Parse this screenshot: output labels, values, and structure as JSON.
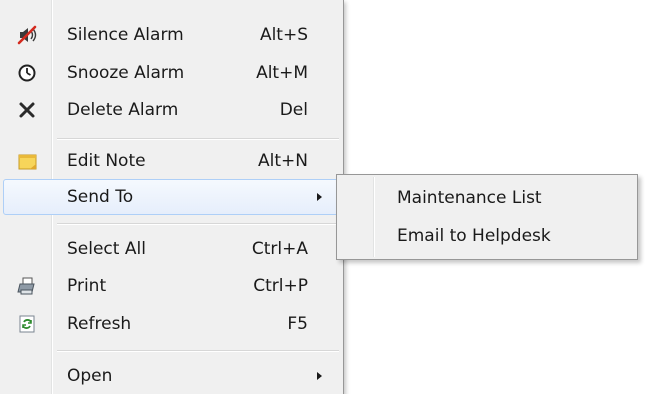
{
  "context_menu": {
    "items": [
      {
        "label": "Silence Alarm",
        "shortcut": "Alt+S",
        "icon": "speaker-muted-icon"
      },
      {
        "label": "Snooze Alarm",
        "shortcut": "Alt+M",
        "icon": "clock-icon"
      },
      {
        "label": "Delete Alarm",
        "shortcut": "Del",
        "icon": "delete-x-icon"
      },
      {
        "label": "Edit Note",
        "shortcut": "Alt+N",
        "icon": "sticky-note-icon"
      },
      {
        "label": "Send To",
        "shortcut": "",
        "icon": "",
        "submenu_arrow": "submenu-arrow-icon",
        "highlighted": true
      },
      {
        "label": "Select All",
        "shortcut": "Ctrl+A",
        "icon": ""
      },
      {
        "label": "Print",
        "shortcut": "Ctrl+P",
        "icon": "printer-icon"
      },
      {
        "label": "Refresh",
        "shortcut": "F5",
        "icon": "refresh-icon"
      },
      {
        "label": "Open",
        "shortcut": "",
        "icon": "",
        "submenu_arrow": "submenu-arrow-icon"
      }
    ]
  },
  "send_to_submenu": {
    "items": [
      {
        "label": "Maintenance List"
      },
      {
        "label": "Email to Helpdesk"
      }
    ]
  },
  "colors": {
    "menu_background": "#f0f0f0",
    "highlight_fill": "#e6eefb",
    "highlight_border": "#aecff7",
    "menu_border": "#979797",
    "text": "#1a1a1a"
  }
}
